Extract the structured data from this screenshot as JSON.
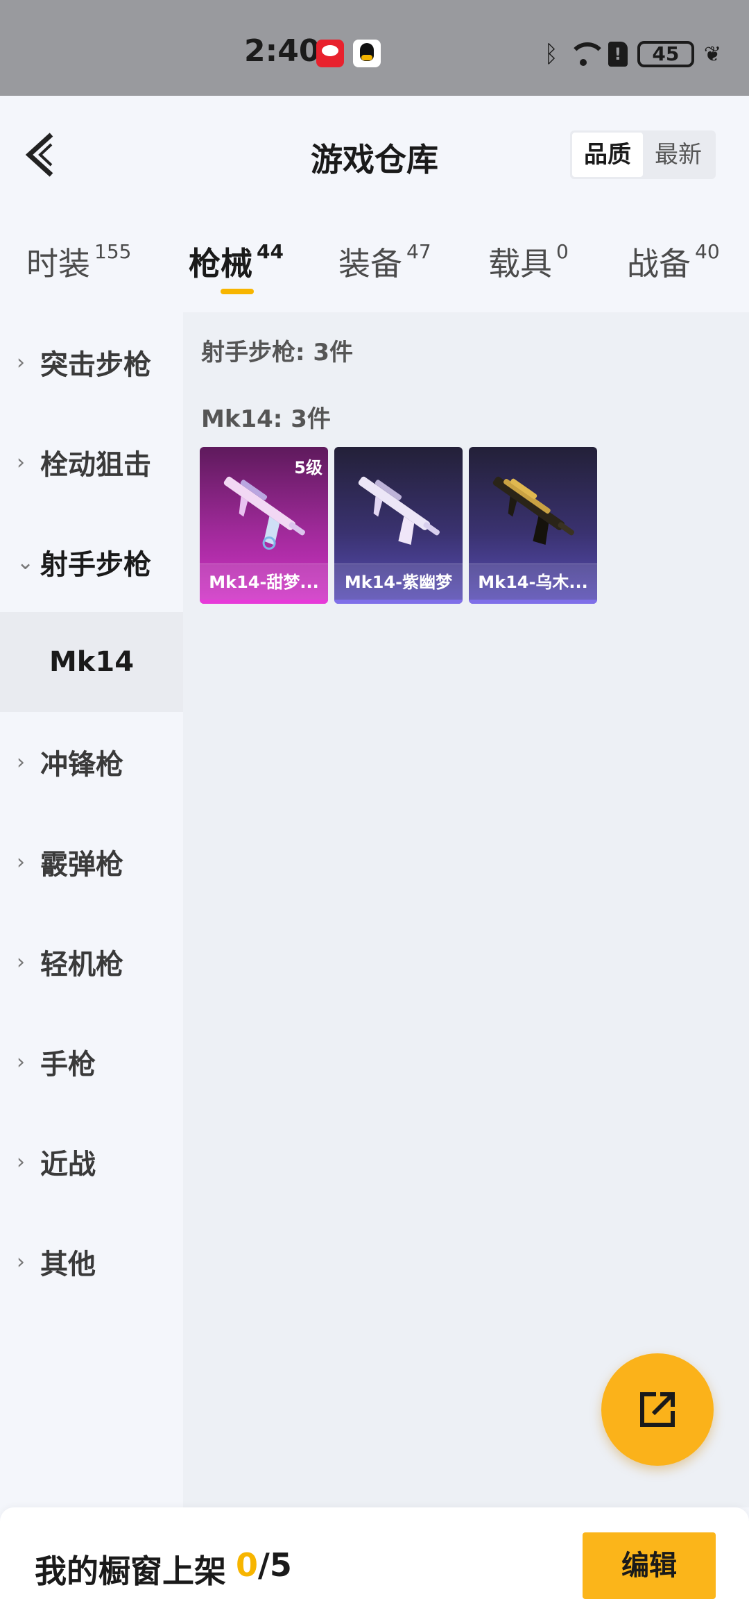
{
  "status_bar": {
    "time": "2:40",
    "battery": "45",
    "sim_label": "!"
  },
  "header": {
    "title": "游戏仓库",
    "sort_options": [
      "品质",
      "最新"
    ],
    "sort_selected": "品质"
  },
  "tabs": [
    {
      "label": "时装",
      "count": "155"
    },
    {
      "label": "枪械",
      "count": "44"
    },
    {
      "label": "装备",
      "count": "47"
    },
    {
      "label": "载具",
      "count": "0"
    },
    {
      "label": "战备",
      "count": "40"
    }
  ],
  "active_tab": "枪械",
  "sidebar": {
    "items": [
      {
        "label": "突击步枪",
        "chevron": "›"
      },
      {
        "label": "栓动狙击",
        "chevron": "›"
      },
      {
        "label": "射手步枪",
        "chevron": "⌄"
      },
      {
        "label": "冲锋枪",
        "chevron": "›"
      },
      {
        "label": "霰弹枪",
        "chevron": "›"
      },
      {
        "label": "轻机枪",
        "chevron": "›"
      },
      {
        "label": "手枪",
        "chevron": "›"
      },
      {
        "label": "近战",
        "chevron": "›"
      },
      {
        "label": "其他",
        "chevron": "›"
      }
    ],
    "selected_sub": "Mk14"
  },
  "content": {
    "category_title": "射手步枪: 3件",
    "group_title": "Mk14: 3件",
    "items": [
      {
        "name": "Mk14-甜梦...",
        "level": "5级",
        "quality": "pink",
        "color": "#d234c8"
      },
      {
        "name": "Mk14-紫幽梦",
        "level": "",
        "quality": "purple",
        "color": "#5a4fb8"
      },
      {
        "name": "Mk14-乌木...",
        "level": "",
        "quality": "purple",
        "color": "#5a4fb8"
      }
    ]
  },
  "bottom_bar": {
    "label": "我的橱窗上架",
    "count_current": "0",
    "count_total": "/5",
    "edit_label": "编辑"
  },
  "colors": {
    "accent": "#f7b500",
    "fab": "#fbb21a"
  }
}
